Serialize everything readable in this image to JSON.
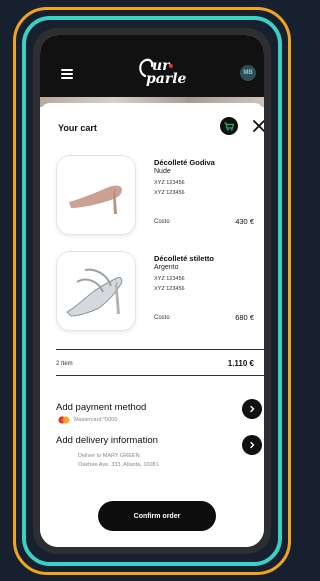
{
  "header": {
    "logo_line1": "ur",
    "logo_line2": "parle",
    "avatar_initials": "MB"
  },
  "cart": {
    "title": "Your cart",
    "items": [
      {
        "name": "Décolleté Godiva",
        "color": "Nude",
        "code1": "XYZ 123456",
        "code2": "XYZ 123456",
        "cost_label": "Costo",
        "cost": "430 €"
      },
      {
        "name": "Décolleté stiletto",
        "color": "Argento",
        "code1": "XYZ 123456",
        "code2": "XYZ 123456",
        "cost_label": "Costo",
        "cost": "680 €"
      }
    ],
    "items_count": "2 Item",
    "total": "1.110 €"
  },
  "payment": {
    "title": "Add payment method",
    "card": "Mastercard *0000"
  },
  "delivery": {
    "title": "Add delivery information",
    "line1": "Deliver to MARY GREEN",
    "line2": "Oaktree Ave. 333, Atlanta, 10081"
  },
  "confirm_label": "Confirm order",
  "colors": {
    "accent_orange": "#f2a51a",
    "accent_teal": "#3ccfc2",
    "cart_green": "#2fb36a"
  }
}
